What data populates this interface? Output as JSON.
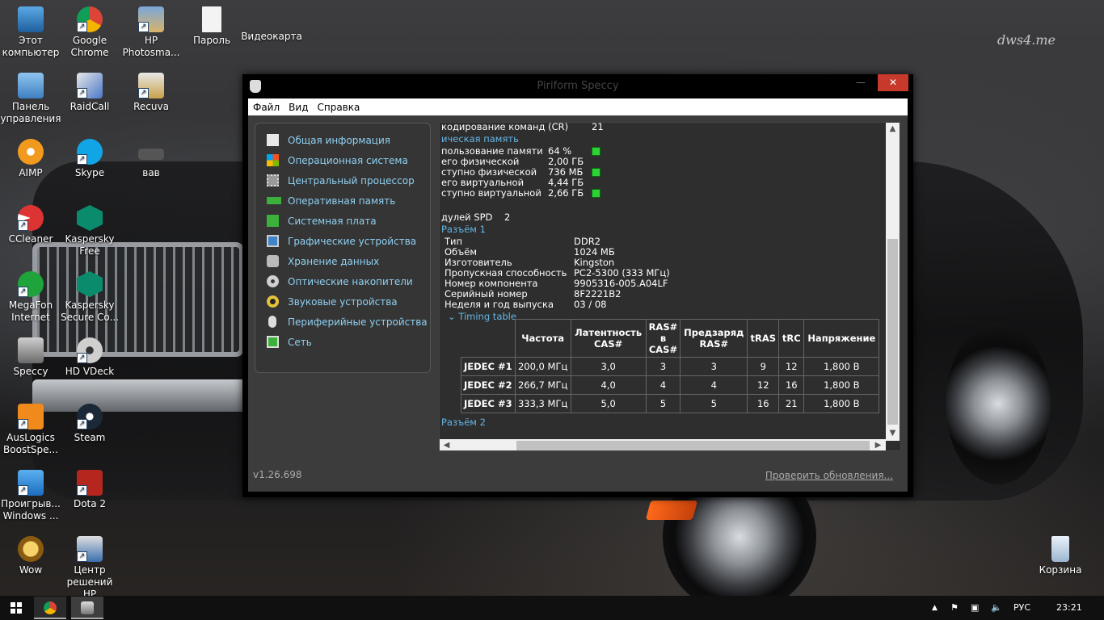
{
  "watermark": "dws4.me",
  "desktop": {
    "icons": [
      {
        "label": "Этот компьютер"
      },
      {
        "label": "Google Chrome"
      },
      {
        "label": "HP Photosma..."
      },
      {
        "label": "Пароль"
      },
      {
        "label": "Видеокарта"
      },
      {
        "label": "Панель управления"
      },
      {
        "label": "RaidCall"
      },
      {
        "label": "Recuva"
      },
      {
        "label": "AIMP"
      },
      {
        "label": "Skype"
      },
      {
        "label": "вав"
      },
      {
        "label": "CCleaner"
      },
      {
        "label": "Kaspersky Free"
      },
      {
        "label": "MegaFon Internet"
      },
      {
        "label": "Kaspersky Secure Co..."
      },
      {
        "label": "Speccy"
      },
      {
        "label": "HD VDeck"
      },
      {
        "label": "AusLogics BoostSpe..."
      },
      {
        "label": "Steam"
      },
      {
        "label": "Проигрыв... Windows ..."
      },
      {
        "label": "Dota 2"
      },
      {
        "label": "Wow"
      },
      {
        "label": "Центр решений HP"
      },
      {
        "label": "Корзина"
      }
    ]
  },
  "window": {
    "title": "Piriform Speccy",
    "controls": {
      "minimize": "—",
      "maximize": "☐",
      "close": "✕"
    },
    "menu": [
      "Файл",
      "Вид",
      "Справка"
    ],
    "sidebar": [
      {
        "label": "Общая информация",
        "color": "#e8e8e8"
      },
      {
        "label": "Операционная система",
        "color": "#e0522a"
      },
      {
        "label": "Центральный процессор",
        "color": "#9a9a9a"
      },
      {
        "label": "Оперативная память",
        "color": "#3bb03b"
      },
      {
        "label": "Системная плата",
        "color": "#3bb03b"
      },
      {
        "label": "Графические устройства",
        "color": "#3f83c9"
      },
      {
        "label": "Хранение данных",
        "color": "#bbbbbb"
      },
      {
        "label": "Оптические накопители",
        "color": "#d0d0d0"
      },
      {
        "label": "Звуковые устройства",
        "color": "#e4c23a"
      },
      {
        "label": "Периферийные устройства",
        "color": "#dddddd"
      },
      {
        "label": "Сеть",
        "color": "#3bb03b"
      }
    ],
    "content": {
      "cr_label": "кодирование команд (CR)",
      "cr_value": "21",
      "phys_mem_section": "ическая память",
      "usage_label": "пользование памяти",
      "usage_value": "64 %",
      "total_phys_label": "его физической",
      "total_phys_value": "2,00 ГБ",
      "avail_phys_label": "ступно физической",
      "avail_phys_value": "736 МБ",
      "total_virt_label": "его виртуальной",
      "total_virt_value": "4,44 ГБ",
      "avail_virt_label": "ступно виртуальной",
      "avail_virt_value": "2,66 ГБ",
      "spd_label": "дулей SPD",
      "spd_value": "2",
      "slot1": "Разъём 1",
      "slot1_props": [
        {
          "key": "Тип",
          "value": "DDR2"
        },
        {
          "key": "Объём",
          "value": "1024 МБ"
        },
        {
          "key": "Изготовитель",
          "value": "Kingston"
        },
        {
          "key": "Пропускная способность",
          "value": "PC2-5300 (333 МГц)"
        },
        {
          "key": "Номер компонента",
          "value": "9905316-005.A04LF"
        },
        {
          "key": "Серийный номер",
          "value": "8F2221B2"
        },
        {
          "key": "Неделя и год выпуска",
          "value": "03 / 08"
        }
      ],
      "timing_toggle": "Timing table",
      "timing_headers": [
        "Частота",
        "Латентность CAS#",
        "RAS# в CAS#",
        "Предзаряд RAS#",
        "tRAS",
        "tRC",
        "Напряжение"
      ],
      "timing_rows": [
        {
          "name": "JEDEC #1",
          "cells": [
            "200,0 МГц",
            "3,0",
            "3",
            "3",
            "9",
            "12",
            "1,800 В"
          ]
        },
        {
          "name": "JEDEC #2",
          "cells": [
            "266,7 МГц",
            "4,0",
            "4",
            "4",
            "12",
            "16",
            "1,800 В"
          ]
        },
        {
          "name": "JEDEC #3",
          "cells": [
            "333,3 МГц",
            "5,0",
            "5",
            "5",
            "16",
            "21",
            "1,800 В"
          ]
        }
      ],
      "slot2": "Разъём 2"
    },
    "version": "v1.26.698",
    "update_link": "Проверить обновления..."
  },
  "taskbar": {
    "language": "РУС",
    "time": "23:21"
  }
}
